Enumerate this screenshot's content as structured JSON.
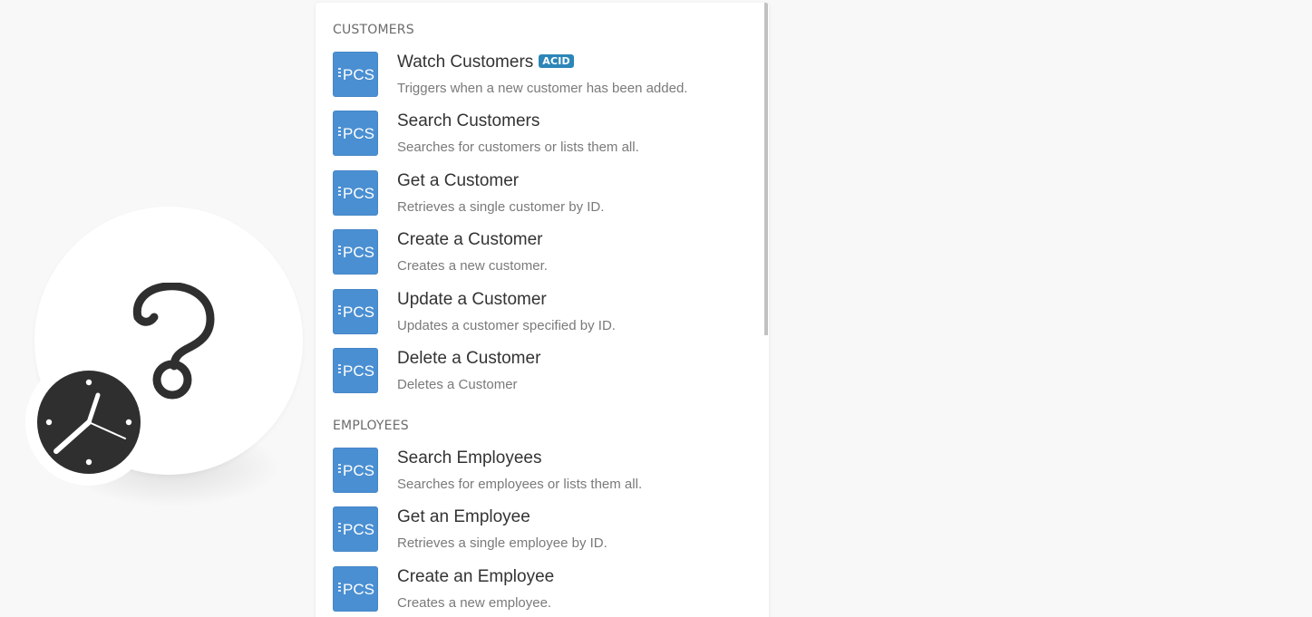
{
  "colors": {
    "app_icon_bg": "#4a8fd2",
    "badge_bg": "#2c86b8",
    "clock_dark": "#2f2f2f"
  },
  "module": {
    "main_icon": "question-mark-icon",
    "badge_icon": "clock-icon"
  },
  "app_icon": {
    "name": "pcs-app-icon",
    "text": "PCS"
  },
  "sections": [
    {
      "title": "Customers",
      "items": [
        {
          "title": "Watch Customers",
          "badge": "ACID",
          "description": "Triggers when a new customer has been added."
        },
        {
          "title": "Search Customers",
          "description": "Searches for customers or lists them all."
        },
        {
          "title": "Get a Customer",
          "description": "Retrieves a single customer by ID."
        },
        {
          "title": "Create a Customer",
          "description": "Creates a new customer."
        },
        {
          "title": "Update a Customer",
          "description": "Updates a customer specified by ID."
        },
        {
          "title": "Delete a Customer",
          "description": "Deletes a Customer"
        }
      ]
    },
    {
      "title": "Employees",
      "items": [
        {
          "title": "Search Employees",
          "description": "Searches for employees or lists them all."
        },
        {
          "title": "Get an Employee",
          "description": "Retrieves a single employee by ID."
        },
        {
          "title": "Create an Employee",
          "description": "Creates a new employee."
        }
      ]
    }
  ]
}
